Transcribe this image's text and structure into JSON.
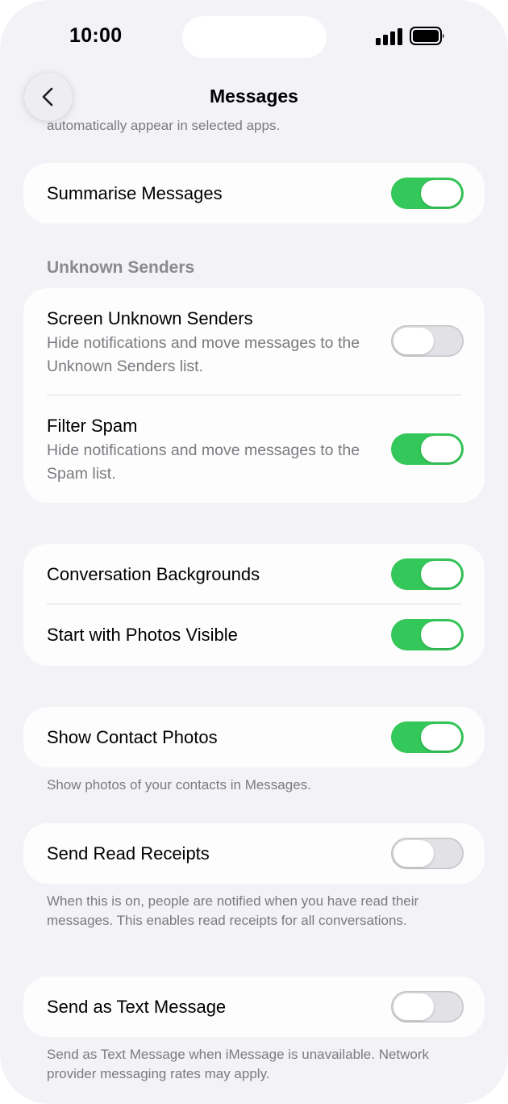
{
  "status_bar": {
    "time": "10:00",
    "signal_icon": "cellular-signal-icon",
    "battery_icon": "battery-full-icon"
  },
  "nav": {
    "title": "Messages",
    "back_icon": "chevron-left-icon"
  },
  "top_note_clipped": "automatically appear in selected apps.",
  "summarise": {
    "label": "Summarise Messages",
    "on": true
  },
  "unknown_senders": {
    "header": "Unknown Senders",
    "screen": {
      "label": "Screen Unknown Senders",
      "description": "Hide notifications and move messages to the Unknown Senders list.",
      "on": false
    },
    "filter_spam": {
      "label": "Filter Spam",
      "description": "Hide notifications and move messages to the Spam list.",
      "on": true
    }
  },
  "backgrounds": {
    "conversation_backgrounds": {
      "label": "Conversation Backgrounds",
      "on": true
    },
    "photos_visible": {
      "label": "Start with Photos Visible",
      "on": true
    }
  },
  "contact_photos": {
    "label": "Show Contact Photos",
    "on": true,
    "footnote": "Show photos of your contacts in Messages."
  },
  "read_receipts": {
    "label": "Send Read Receipts",
    "on": false,
    "footnote": "When this is on, people are notified when you have read their messages. This enables read receipts for all conversations."
  },
  "text_message": {
    "label": "Send as Text Message",
    "on": false,
    "footnote": "Send as Text Message when iMessage is unavailable. Network provider messaging rates may apply."
  },
  "colors": {
    "toggle_on": "#34c759",
    "background": "#f2f2f7",
    "card": "#fdfdfd"
  }
}
